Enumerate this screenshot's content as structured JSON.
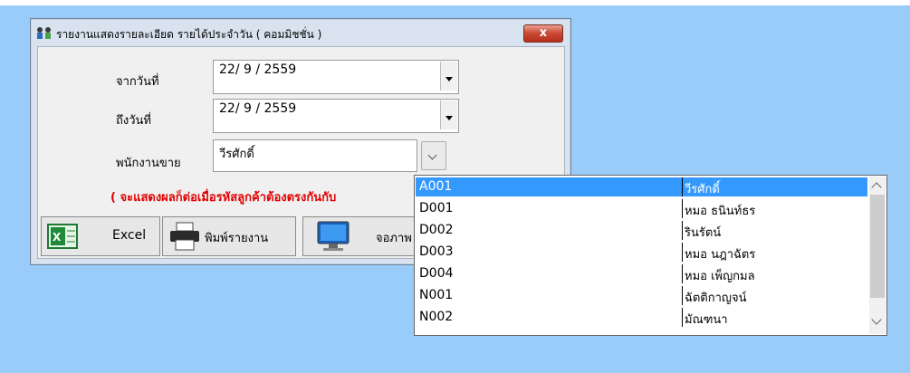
{
  "window": {
    "title": "รายงานแสดงรายละเอียด รายได้ประจำวัน ( คอมมิชชั่น )",
    "close_label": "x"
  },
  "form": {
    "from_date_label": "จากวันที่",
    "from_date_value": "22/ 9 / 2559",
    "to_date_label": "ถึงวันที่",
    "to_date_value": "22/ 9 / 2559",
    "salesperson_label": "พนักงานขาย",
    "salesperson_value": "วีรศักดิ์",
    "warning_text": "( จะแสดงผลก็ต่อเมื่อรหัสลูกค้าต้องตรงกันกับ"
  },
  "buttons": {
    "excel_label": "Excel",
    "print_label": "พิมพ์รายงาน",
    "screen_label": "จอภาพ"
  },
  "dropdown": {
    "rows": [
      {
        "code": "A001",
        "name": "วีรศักดิ์"
      },
      {
        "code": "D001",
        "name": "หมอ ธนินท์ธร"
      },
      {
        "code": "D002",
        "name": "รินรัตน์"
      },
      {
        "code": "D003",
        "name": "หมอ นฎาฉัตร"
      },
      {
        "code": "D004",
        "name": "หมอ เพ็ญกมล"
      },
      {
        "code": "N001",
        "name": "ฉัตติกาญจน์"
      },
      {
        "code": "N002",
        "name": "มัณฑนา"
      }
    ]
  }
}
